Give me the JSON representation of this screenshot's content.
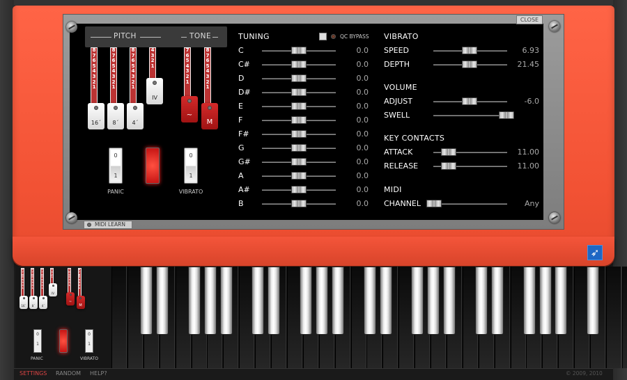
{
  "window": {
    "close_label": "CLOSE",
    "midi_learn_label": "MIDI LEARN"
  },
  "drawbars": {
    "pitch_label": "PITCH",
    "tone_label": "TONE",
    "scale_digits": [
      "8",
      "7",
      "6",
      "5",
      "4",
      "3",
      "2",
      "1"
    ],
    "pitch_tabs": [
      "16´",
      "8´",
      "4´",
      "IV"
    ],
    "tone_tabs": [
      "~",
      "M"
    ],
    "panic_label": "PANIC",
    "vibrato_label": "VIBRATO",
    "rocker_top": "0",
    "rocker_bottom": "1"
  },
  "tuning": {
    "title": "TUNING",
    "qc_bypass_label": "QC BYPASS",
    "notes": [
      {
        "name": "C",
        "value": "0.0"
      },
      {
        "name": "C#",
        "value": "0.0"
      },
      {
        "name": "D",
        "value": "0.0"
      },
      {
        "name": "D#",
        "value": "0.0"
      },
      {
        "name": "E",
        "value": "0.0"
      },
      {
        "name": "F",
        "value": "0.0"
      },
      {
        "name": "F#",
        "value": "0.0"
      },
      {
        "name": "G",
        "value": "0.0"
      },
      {
        "name": "G#",
        "value": "0.0"
      },
      {
        "name": "A",
        "value": "0.0"
      },
      {
        "name": "A#",
        "value": "0.0"
      },
      {
        "name": "B",
        "value": "0.0"
      }
    ]
  },
  "vibrato": {
    "title": "VIBRATO",
    "speed_label": "SPEED",
    "speed_value": "6.93",
    "depth_label": "DEPTH",
    "depth_value": "21.45"
  },
  "volume": {
    "title": "VOLUME",
    "adjust_label": "ADJUST",
    "adjust_value": "-6.0",
    "swell_label": "SWELL"
  },
  "key_contacts": {
    "title": "KEY CONTACTS",
    "attack_label": "ATTACK",
    "attack_value": "11.00",
    "release_label": "RELEASE",
    "release_value": "11.00"
  },
  "midi": {
    "title": "MIDI",
    "channel_label": "CHANNEL",
    "channel_value": "Any"
  },
  "bottom_nav": {
    "settings": "SETTINGS",
    "random": "RANDOM",
    "help": "HELP?"
  },
  "copyright": "© 2009, 2010",
  "colors": {
    "body": "#f25234",
    "panel": "#000000",
    "accent_red": "#c31212"
  }
}
